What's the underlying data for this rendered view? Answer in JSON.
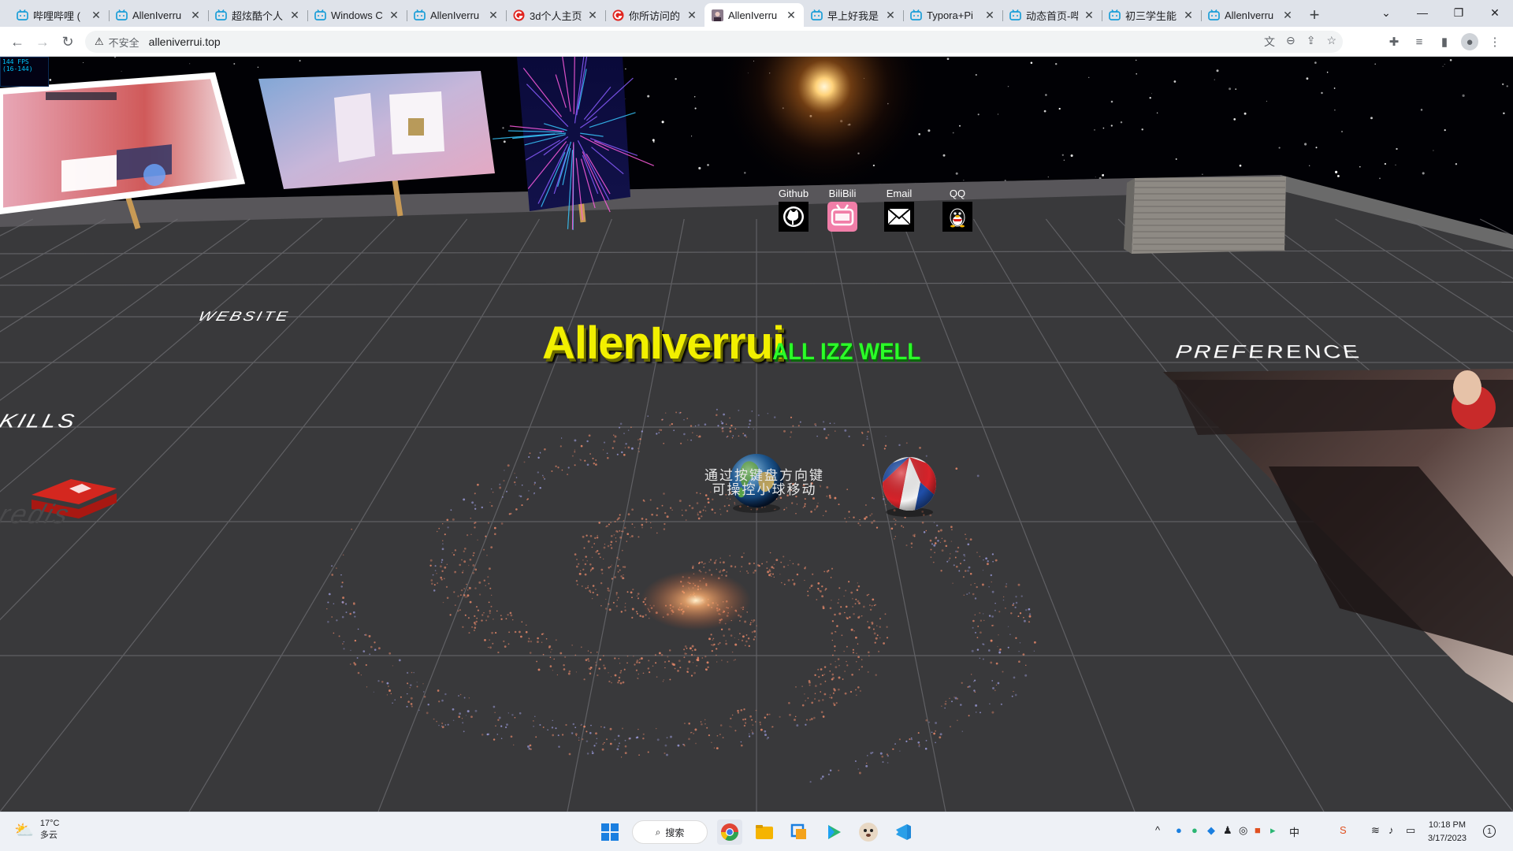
{
  "browser": {
    "tabs": [
      {
        "title": "哔哩哔哩 (",
        "icon": "bilibili-tv-icon",
        "active": false
      },
      {
        "title": "AllenIverru",
        "icon": "bilibili-tv-icon",
        "active": false
      },
      {
        "title": "超炫酷个人",
        "icon": "bilibili-tv-icon",
        "active": false
      },
      {
        "title": "Windows C",
        "icon": "bilibili-tv-icon",
        "active": false
      },
      {
        "title": "AllenIverru",
        "icon": "bilibili-tv-icon",
        "active": false
      },
      {
        "title": "3d个人主页",
        "icon": "red-g-icon",
        "active": false
      },
      {
        "title": "你所访问的",
        "icon": "red-g-icon",
        "active": false
      },
      {
        "title": "AllenIverru",
        "icon": "avatar-icon",
        "active": true
      },
      {
        "title": "早上好我是",
        "icon": "bilibili-tv-icon",
        "active": false
      },
      {
        "title": "Typora+Pi",
        "icon": "bilibili-tv-icon",
        "active": false
      },
      {
        "title": "动态首页-哔",
        "icon": "bilibili-tv-icon",
        "active": false
      },
      {
        "title": "初三学生能",
        "icon": "bilibili-tv-icon",
        "active": false
      },
      {
        "title": "AllenIverru",
        "icon": "bilibili-tv-icon",
        "active": false
      }
    ],
    "security_label": "不安全",
    "url": "alleniverrui.top"
  },
  "scene": {
    "fps_text": "144 FPS (16-144)",
    "social": [
      {
        "label": "Github",
        "icon": "github-icon"
      },
      {
        "label": "BiliBili",
        "icon": "bilibili-icon"
      },
      {
        "label": "Email",
        "icon": "email-icon"
      },
      {
        "label": "QQ",
        "icon": "qq-penguin-icon"
      }
    ],
    "title": "AllenIverrui",
    "subtitle": "ALL IZZ WELL",
    "hint_line1": "通过按键盘方向键",
    "hint_line2": "可操控小球移动",
    "floor_words": {
      "website": "WEBSITE",
      "skills": "KILLS",
      "preference": "PREFERENCE",
      "redis": "redis"
    },
    "colors": {
      "title": "#f2f000",
      "subtitle": "#2bff28",
      "floor": "#3a3a3c",
      "galaxy": "#e8896a"
    }
  },
  "taskbar": {
    "weather_temp": "17°C",
    "weather_desc": "多云",
    "search_label": "搜索",
    "ime_label": "中",
    "time": "10:18 PM",
    "date": "3/17/2023",
    "notification_count": "1"
  }
}
